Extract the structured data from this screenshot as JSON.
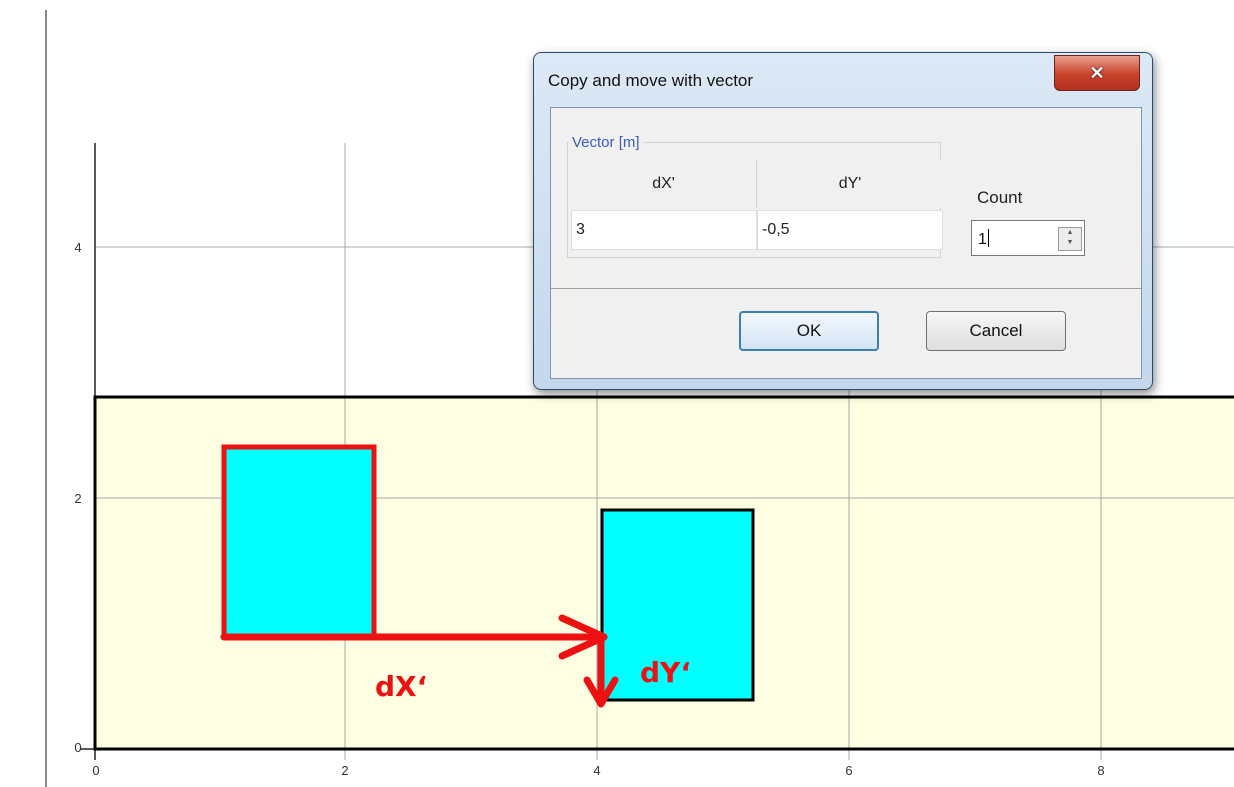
{
  "plot": {
    "x_ticks": [
      "0",
      "2",
      "4",
      "6",
      "8"
    ],
    "y_ticks": [
      "0",
      "2",
      "4"
    ],
    "colors": {
      "domain_fill": "#fefee2",
      "rect_fill": "#00ffff",
      "highlight": "#ee1111",
      "grid": "#a8a8a8"
    },
    "annotation_dx": "dX‘",
    "annotation_dy": "dY‘"
  },
  "dialog": {
    "title": "Copy and move  with vector",
    "close_glyph": "✕",
    "group_label": "Vector [m]",
    "columns": [
      "dX'",
      "dY'"
    ],
    "values": [
      "3",
      "-0,5"
    ],
    "count_label": "Count",
    "count_value": "1",
    "spin_up_glyph": "▲",
    "spin_down_glyph": "▼",
    "ok_label": "OK",
    "cancel_label": "Cancel"
  }
}
